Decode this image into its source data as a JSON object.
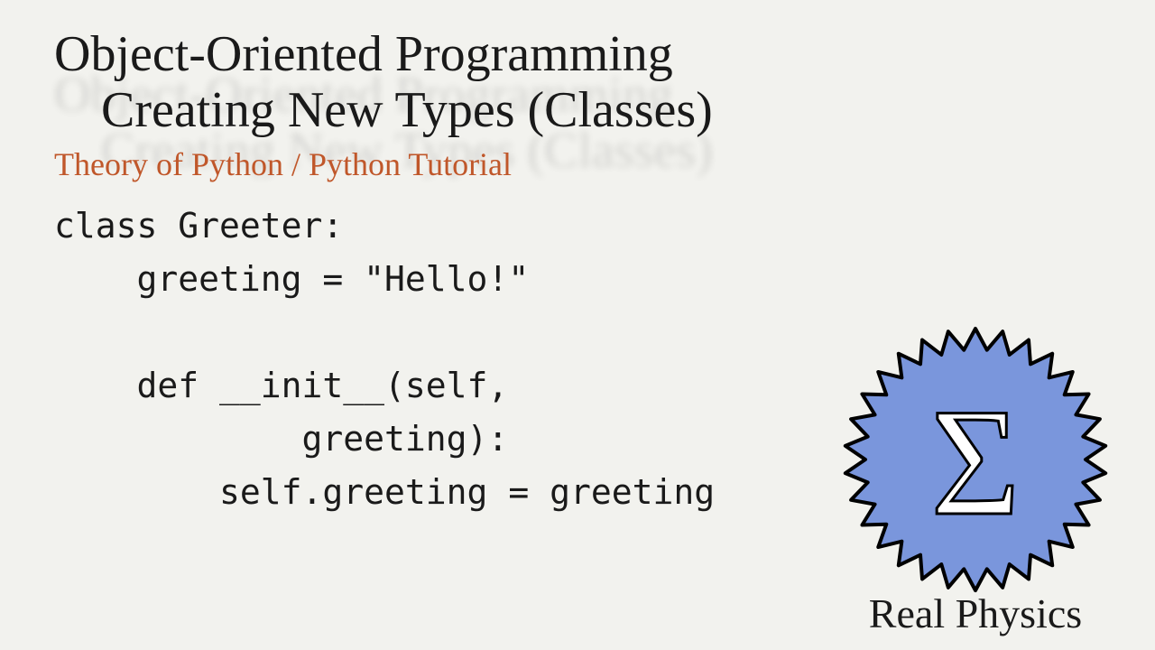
{
  "title_line1": "Object-Oriented Programming",
  "title_line2": "Creating New Types (Classes)",
  "subtitle": "Theory of Python / Python Tutorial",
  "code": "class Greeter:\n    greeting = \"Hello!\"\n\n    def __init__(self,\n            greeting):\n        self.greeting = greeting",
  "brand": "Real Physics",
  "sigma": "Σ"
}
